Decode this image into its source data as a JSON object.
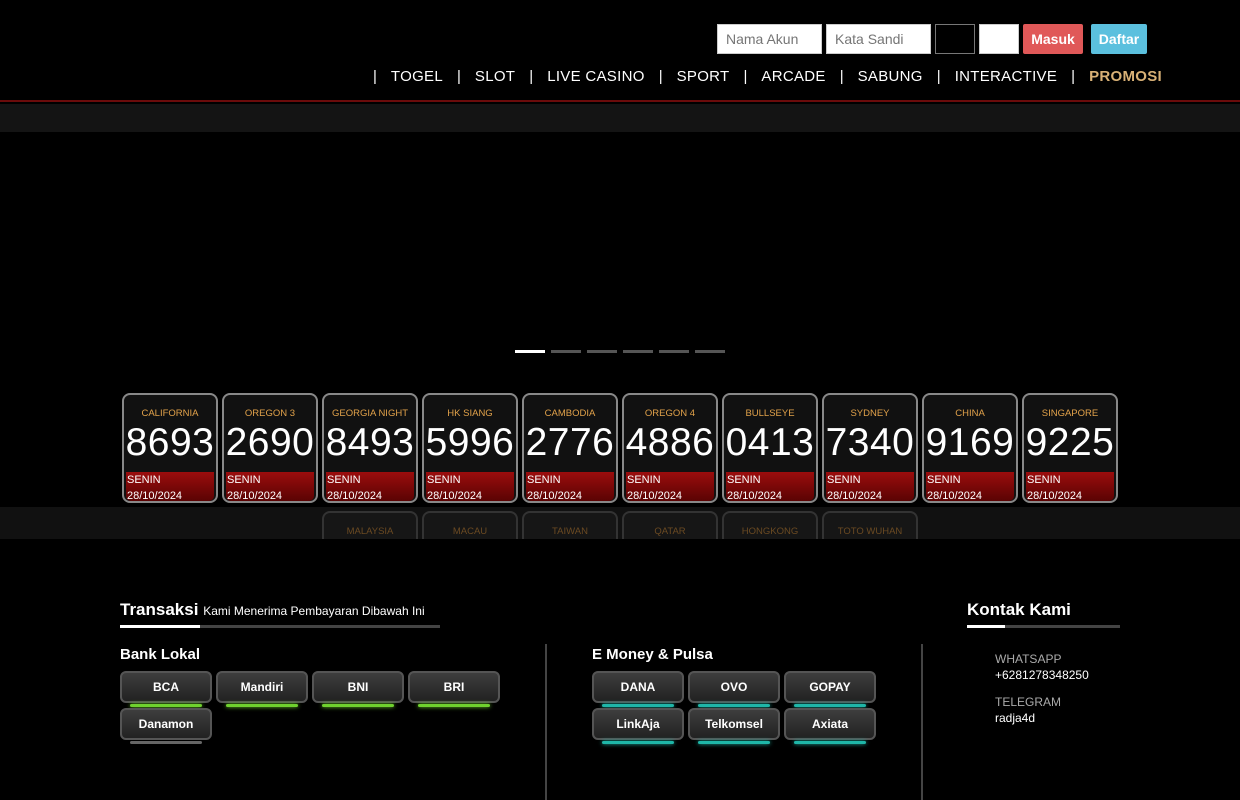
{
  "login": {
    "username_placeholder": "Nama Akun",
    "password_placeholder": "Kata Sandi",
    "login_label": "Masuk",
    "register_label": "Daftar"
  },
  "nav": {
    "items": [
      "TOGEL",
      "SLOT",
      "LIVE CASINO",
      "SPORT",
      "ARCADE",
      "SABUNG",
      "INTERACTIVE"
    ],
    "promo": "PROMOSI",
    "separator": "|"
  },
  "slider": {
    "slides": 6,
    "active": 1
  },
  "results": [
    {
      "city": "CALIFORNIA",
      "number": "8693",
      "day": "SENIN",
      "date": "28/10/2024"
    },
    {
      "city": "OREGON 3",
      "number": "2690",
      "day": "SENIN",
      "date": "28/10/2024"
    },
    {
      "city": "GEORGIA NIGHT",
      "number": "8493",
      "day": "SENIN",
      "date": "28/10/2024"
    },
    {
      "city": "HK SIANG",
      "number": "5996",
      "day": "SENIN",
      "date": "28/10/2024"
    },
    {
      "city": "CAMBODIA",
      "number": "2776",
      "day": "SENIN",
      "date": "28/10/2024"
    },
    {
      "city": "OREGON 4",
      "number": "4886",
      "day": "SENIN",
      "date": "28/10/2024"
    },
    {
      "city": "BULLSEYE",
      "number": "0413",
      "day": "SENIN",
      "date": "28/10/2024"
    },
    {
      "city": "SYDNEY",
      "number": "7340",
      "day": "SENIN",
      "date": "28/10/2024"
    },
    {
      "city": "CHINA",
      "number": "9169",
      "day": "SENIN",
      "date": "28/10/2024"
    },
    {
      "city": "SINGAPORE",
      "number": "9225",
      "day": "SENIN",
      "date": "28/10/2024"
    }
  ],
  "results_row2": [
    "MALAYSIA",
    "MACAU",
    "TAIWAN",
    "QATAR",
    "HONGKONG",
    "TOTO WUHAN"
  ],
  "transaksi": {
    "title": "Transaksi",
    "subtitle": "Kami Menerima Pembayaran Dibawah Ini",
    "bank_title": "Bank Lokal",
    "banks": [
      "BCA",
      "Mandiri",
      "BNI",
      "BRI",
      "Danamon"
    ],
    "emoney_title": "E Money & Pulsa",
    "emoney": [
      "DANA",
      "OVO",
      "GOPAY",
      "LinkAja",
      "Telkomsel",
      "Axiata"
    ]
  },
  "contact": {
    "title": "Kontak Kami",
    "whatsapp_label": "WHATSAPP",
    "whatsapp_value": "+6281278348250",
    "telegram_label": "TELEGRAM",
    "telegram_value": "radja4d"
  }
}
